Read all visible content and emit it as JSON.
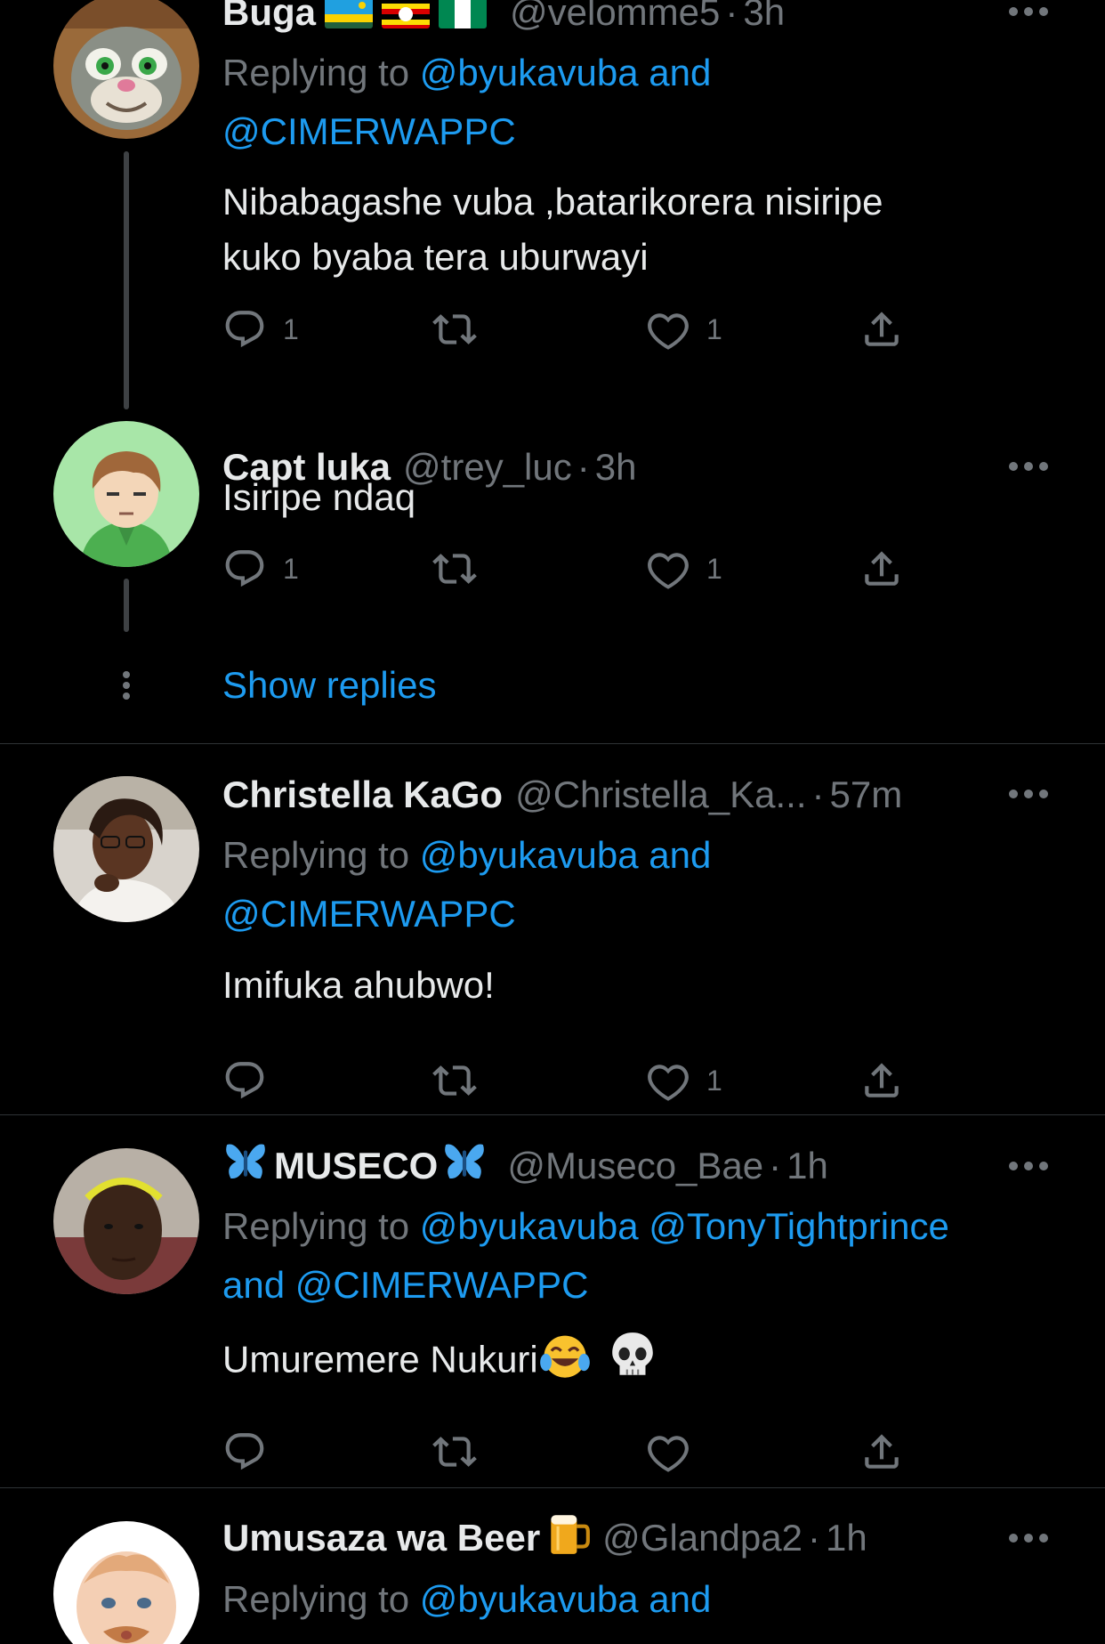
{
  "tweets": [
    {
      "name": "Buga",
      "handle": "@velomme5",
      "time": "3h",
      "replying_prefix": "Replying to",
      "replying_link1": "@byukavuba and",
      "replying_link2": "@CIMERWAPPC",
      "text_line1": "Nibabagashe vuba ,batarikorera nisiripe",
      "text_line2": "kuko byaba tera uburwayi",
      "reply_count": "1",
      "like_count": "1"
    },
    {
      "name": "Capt luka",
      "handle": "@trey_luc",
      "time": "3h",
      "text": "Isiripe ndaq",
      "reply_count": "1",
      "like_count": "1"
    },
    {
      "name": "Christella KaGo",
      "handle": "@Christella_Ka...",
      "time": "57m",
      "replying_prefix": "Replying to",
      "replying_link1": "@byukavuba and",
      "replying_link2": "@CIMERWAPPC",
      "text": "Imifuka ahubwo!",
      "like_count": "1"
    },
    {
      "name": "MUSECO",
      "handle": "@Museco_Bae",
      "time": "1h",
      "replying_prefix": "Replying to",
      "replying_link1": "@byukavuba @TonyTightprince",
      "replying_link2": "and @CIMERWAPPC",
      "text": "Umuremere Nukuri"
    },
    {
      "name": "Umusaza wa Beer",
      "handle": "@Glandpa2",
      "time": "1h",
      "replying_prefix": "Replying to",
      "replying_link1": "@byukavuba and"
    }
  ],
  "show_replies": "Show replies",
  "dot_sep": "·",
  "colors": {
    "link": "#1d9bf0",
    "muted": "#71767b",
    "text": "#e7e9ea",
    "bg": "#000000"
  }
}
